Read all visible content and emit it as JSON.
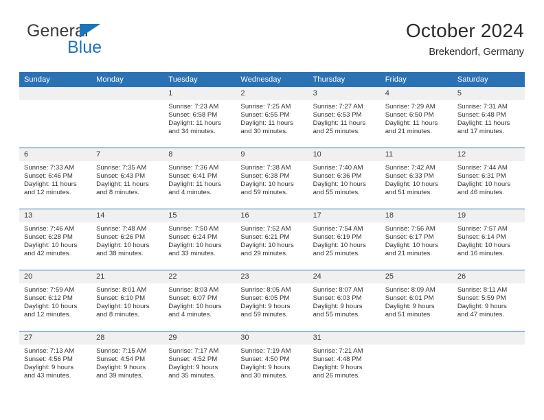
{
  "brand": {
    "name_top": "General",
    "name_bottom": "Blue",
    "triangle_color": "#1b74bb"
  },
  "header": {
    "title": "October 2024",
    "subtitle": "Brekendorf, Germany"
  },
  "theme": {
    "header_blue": "#2b72b5",
    "daynum_band": "#f0f0f0",
    "text": "#333333"
  },
  "weekdays": [
    "Sunday",
    "Monday",
    "Tuesday",
    "Wednesday",
    "Thursday",
    "Friday",
    "Saturday"
  ],
  "labels": {
    "sunrise_prefix": "Sunrise:",
    "sunset_prefix": "Sunset:",
    "daylight_prefix": "Daylight:"
  },
  "weeks": [
    [
      {
        "day": "",
        "sunrise": "",
        "sunset": "",
        "daylight_line1": "",
        "daylight_line2": ""
      },
      {
        "day": "",
        "sunrise": "",
        "sunset": "",
        "daylight_line1": "",
        "daylight_line2": ""
      },
      {
        "day": "1",
        "sunrise": "Sunrise: 7:23 AM",
        "sunset": "Sunset: 6:58 PM",
        "daylight_line1": "Daylight: 11 hours",
        "daylight_line2": "and 34 minutes."
      },
      {
        "day": "2",
        "sunrise": "Sunrise: 7:25 AM",
        "sunset": "Sunset: 6:55 PM",
        "daylight_line1": "Daylight: 11 hours",
        "daylight_line2": "and 30 minutes."
      },
      {
        "day": "3",
        "sunrise": "Sunrise: 7:27 AM",
        "sunset": "Sunset: 6:53 PM",
        "daylight_line1": "Daylight: 11 hours",
        "daylight_line2": "and 25 minutes."
      },
      {
        "day": "4",
        "sunrise": "Sunrise: 7:29 AM",
        "sunset": "Sunset: 6:50 PM",
        "daylight_line1": "Daylight: 11 hours",
        "daylight_line2": "and 21 minutes."
      },
      {
        "day": "5",
        "sunrise": "Sunrise: 7:31 AM",
        "sunset": "Sunset: 6:48 PM",
        "daylight_line1": "Daylight: 11 hours",
        "daylight_line2": "and 17 minutes."
      }
    ],
    [
      {
        "day": "6",
        "sunrise": "Sunrise: 7:33 AM",
        "sunset": "Sunset: 6:46 PM",
        "daylight_line1": "Daylight: 11 hours",
        "daylight_line2": "and 12 minutes."
      },
      {
        "day": "7",
        "sunrise": "Sunrise: 7:35 AM",
        "sunset": "Sunset: 6:43 PM",
        "daylight_line1": "Daylight: 11 hours",
        "daylight_line2": "and 8 minutes."
      },
      {
        "day": "8",
        "sunrise": "Sunrise: 7:36 AM",
        "sunset": "Sunset: 6:41 PM",
        "daylight_line1": "Daylight: 11 hours",
        "daylight_line2": "and 4 minutes."
      },
      {
        "day": "9",
        "sunrise": "Sunrise: 7:38 AM",
        "sunset": "Sunset: 6:38 PM",
        "daylight_line1": "Daylight: 10 hours",
        "daylight_line2": "and 59 minutes."
      },
      {
        "day": "10",
        "sunrise": "Sunrise: 7:40 AM",
        "sunset": "Sunset: 6:36 PM",
        "daylight_line1": "Daylight: 10 hours",
        "daylight_line2": "and 55 minutes."
      },
      {
        "day": "11",
        "sunrise": "Sunrise: 7:42 AM",
        "sunset": "Sunset: 6:33 PM",
        "daylight_line1": "Daylight: 10 hours",
        "daylight_line2": "and 51 minutes."
      },
      {
        "day": "12",
        "sunrise": "Sunrise: 7:44 AM",
        "sunset": "Sunset: 6:31 PM",
        "daylight_line1": "Daylight: 10 hours",
        "daylight_line2": "and 46 minutes."
      }
    ],
    [
      {
        "day": "13",
        "sunrise": "Sunrise: 7:46 AM",
        "sunset": "Sunset: 6:28 PM",
        "daylight_line1": "Daylight: 10 hours",
        "daylight_line2": "and 42 minutes."
      },
      {
        "day": "14",
        "sunrise": "Sunrise: 7:48 AM",
        "sunset": "Sunset: 6:26 PM",
        "daylight_line1": "Daylight: 10 hours",
        "daylight_line2": "and 38 minutes."
      },
      {
        "day": "15",
        "sunrise": "Sunrise: 7:50 AM",
        "sunset": "Sunset: 6:24 PM",
        "daylight_line1": "Daylight: 10 hours",
        "daylight_line2": "and 33 minutes."
      },
      {
        "day": "16",
        "sunrise": "Sunrise: 7:52 AM",
        "sunset": "Sunset: 6:21 PM",
        "daylight_line1": "Daylight: 10 hours",
        "daylight_line2": "and 29 minutes."
      },
      {
        "day": "17",
        "sunrise": "Sunrise: 7:54 AM",
        "sunset": "Sunset: 6:19 PM",
        "daylight_line1": "Daylight: 10 hours",
        "daylight_line2": "and 25 minutes."
      },
      {
        "day": "18",
        "sunrise": "Sunrise: 7:56 AM",
        "sunset": "Sunset: 6:17 PM",
        "daylight_line1": "Daylight: 10 hours",
        "daylight_line2": "and 21 minutes."
      },
      {
        "day": "19",
        "sunrise": "Sunrise: 7:57 AM",
        "sunset": "Sunset: 6:14 PM",
        "daylight_line1": "Daylight: 10 hours",
        "daylight_line2": "and 16 minutes."
      }
    ],
    [
      {
        "day": "20",
        "sunrise": "Sunrise: 7:59 AM",
        "sunset": "Sunset: 6:12 PM",
        "daylight_line1": "Daylight: 10 hours",
        "daylight_line2": "and 12 minutes."
      },
      {
        "day": "21",
        "sunrise": "Sunrise: 8:01 AM",
        "sunset": "Sunset: 6:10 PM",
        "daylight_line1": "Daylight: 10 hours",
        "daylight_line2": "and 8 minutes."
      },
      {
        "day": "22",
        "sunrise": "Sunrise: 8:03 AM",
        "sunset": "Sunset: 6:07 PM",
        "daylight_line1": "Daylight: 10 hours",
        "daylight_line2": "and 4 minutes."
      },
      {
        "day": "23",
        "sunrise": "Sunrise: 8:05 AM",
        "sunset": "Sunset: 6:05 PM",
        "daylight_line1": "Daylight: 9 hours",
        "daylight_line2": "and 59 minutes."
      },
      {
        "day": "24",
        "sunrise": "Sunrise: 8:07 AM",
        "sunset": "Sunset: 6:03 PM",
        "daylight_line1": "Daylight: 9 hours",
        "daylight_line2": "and 55 minutes."
      },
      {
        "day": "25",
        "sunrise": "Sunrise: 8:09 AM",
        "sunset": "Sunset: 6:01 PM",
        "daylight_line1": "Daylight: 9 hours",
        "daylight_line2": "and 51 minutes."
      },
      {
        "day": "26",
        "sunrise": "Sunrise: 8:11 AM",
        "sunset": "Sunset: 5:59 PM",
        "daylight_line1": "Daylight: 9 hours",
        "daylight_line2": "and 47 minutes."
      }
    ],
    [
      {
        "day": "27",
        "sunrise": "Sunrise: 7:13 AM",
        "sunset": "Sunset: 4:56 PM",
        "daylight_line1": "Daylight: 9 hours",
        "daylight_line2": "and 43 minutes."
      },
      {
        "day": "28",
        "sunrise": "Sunrise: 7:15 AM",
        "sunset": "Sunset: 4:54 PM",
        "daylight_line1": "Daylight: 9 hours",
        "daylight_line2": "and 39 minutes."
      },
      {
        "day": "29",
        "sunrise": "Sunrise: 7:17 AM",
        "sunset": "Sunset: 4:52 PM",
        "daylight_line1": "Daylight: 9 hours",
        "daylight_line2": "and 35 minutes."
      },
      {
        "day": "30",
        "sunrise": "Sunrise: 7:19 AM",
        "sunset": "Sunset: 4:50 PM",
        "daylight_line1": "Daylight: 9 hours",
        "daylight_line2": "and 30 minutes."
      },
      {
        "day": "31",
        "sunrise": "Sunrise: 7:21 AM",
        "sunset": "Sunset: 4:48 PM",
        "daylight_line1": "Daylight: 9 hours",
        "daylight_line2": "and 26 minutes."
      },
      {
        "day": "",
        "sunrise": "",
        "sunset": "",
        "daylight_line1": "",
        "daylight_line2": ""
      },
      {
        "day": "",
        "sunrise": "",
        "sunset": "",
        "daylight_line1": "",
        "daylight_line2": ""
      }
    ]
  ]
}
